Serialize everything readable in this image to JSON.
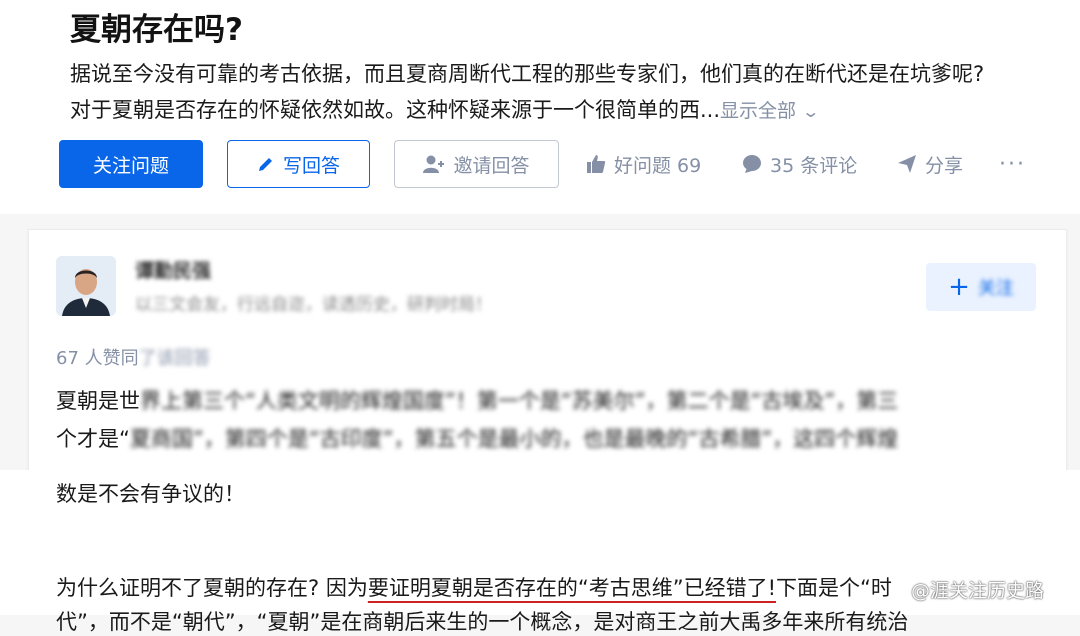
{
  "question": {
    "title": "夏朝存在吗?",
    "desc_line1": "据说至今没有可靠的考古依据，而且夏商周断代工程的那些专家们，他们真的在断代还是在坑爹呢?",
    "desc_line2": "对于夏朝是否存在的怀疑依然如故。这种怀疑来源于一个很简单的西...",
    "show_all": "显示全部",
    "follow_label": "关注问题",
    "answer_label": "写回答",
    "invite_label": "邀请回答",
    "good_question": "好问题 69",
    "comments": "35 条评论",
    "share": "分享",
    "more": "···"
  },
  "answer": {
    "author_name": "谭勤民强",
    "author_bio": "以三文会友，行远自迩，读透历史，研判时局！",
    "follow_label": "关注",
    "votes_visible": "67 人赞同",
    "votes_blur": "了该回答",
    "line1_visible": "夏朝是世",
    "line1_blur": "界上第三个“人类文明的辉煌国度”！第一个是“苏美尔”，第二个是“古埃及”，第三",
    "line2_visible": "个才是“",
    "line2_blur": "夏商国”，第四个是“古印度”，第五个是最小的，也是最晚的“古希腊”，这四个辉煌"
  },
  "continuation": {
    "p1": "数是不会有争议的！",
    "p2_a": "为什么证明不了夏朝的存在? 因为",
    "p2_b": "要证明夏朝是否存在的“考古思维”已经错了!",
    "p2_c": "下面是个“时",
    "p3": "代”，而不是“朝代”，“夏朝”是在商朝后来生的一个概念，是对商王之前大禹多年来所有统治"
  },
  "watermark": "@涯关注历史路",
  "colors": {
    "primary": "#0a66e8",
    "muted": "#8590a6"
  }
}
